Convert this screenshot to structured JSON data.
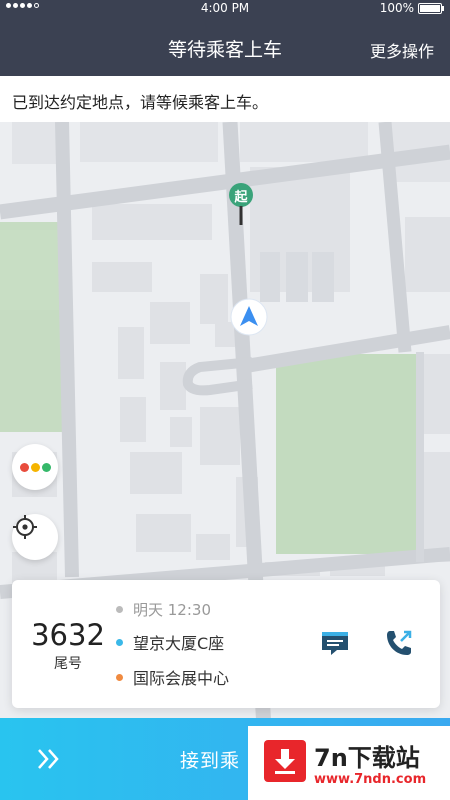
{
  "status_bar": {
    "carrier": "",
    "time": "4:00 PM",
    "battery": "100%"
  },
  "nav": {
    "title": "等待乘客上车",
    "more_label": "更多操作"
  },
  "notice": {
    "text": "已到达约定地点，请等候乘客上车。"
  },
  "map": {
    "pickup_marker_label": "起",
    "traffic_colors": [
      "#e84c3d",
      "#f5b400",
      "#35b86a"
    ],
    "pin_color": "#3aa37a",
    "location_arrow_color": "#3b8ff0"
  },
  "trip": {
    "tail_number": "3632",
    "tail_label": "尾号",
    "time": "明天 12:30",
    "start": "望京大厦C座",
    "end": "国际会展中心",
    "start_dot_color": "#3ab8e8",
    "end_dot_color": "#f08a40",
    "time_dot_color": "#bbbbbb"
  },
  "bottom_action": {
    "label": "接到乘"
  },
  "watermark": {
    "name": "7n下载站",
    "url": "www.7ndn.com"
  }
}
